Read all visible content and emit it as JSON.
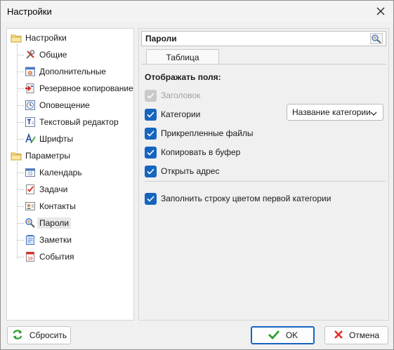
{
  "window": {
    "title": "Настройки"
  },
  "tree": {
    "groups": [
      {
        "label": "Настройки",
        "icon": "folder-icon",
        "items": [
          {
            "label": "Общие",
            "icon": "tools-icon"
          },
          {
            "label": "Дополнительные",
            "icon": "advanced-settings-icon"
          },
          {
            "label": "Резервное копирование",
            "icon": "backup-icon"
          },
          {
            "label": "Оповещение",
            "icon": "notification-icon"
          },
          {
            "label": "Текстовый редактор",
            "icon": "text-editor-icon"
          },
          {
            "label": "Шрифты",
            "icon": "font-icon"
          }
        ]
      },
      {
        "label": "Параметры",
        "icon": "folder-icon",
        "items": [
          {
            "label": "Календарь",
            "icon": "calendar-icon"
          },
          {
            "label": "Задачи",
            "icon": "tasks-icon"
          },
          {
            "label": "Контакты",
            "icon": "contacts-icon"
          },
          {
            "label": "Пароли",
            "icon": "passwords-icon",
            "selected": true
          },
          {
            "label": "Заметки",
            "icon": "notes-icon"
          },
          {
            "label": "События",
            "icon": "events-icon"
          }
        ]
      }
    ]
  },
  "panel": {
    "header": "Пароли",
    "tab": "Таблица",
    "section_title": "Отображать поля:",
    "fields": [
      {
        "label": "Заголовок",
        "checked": true,
        "disabled": true
      },
      {
        "label": "Категории",
        "checked": true
      },
      {
        "label": "Прикрепленные файлы",
        "checked": true
      },
      {
        "label": "Копировать в буфер",
        "checked": true
      },
      {
        "label": "Открыть адрес",
        "checked": true
      }
    ],
    "category_dropdown": "Название категории",
    "fill_row_option": {
      "label": "Заполнить строку цветом первой категории",
      "checked": true
    }
  },
  "buttons": {
    "reset": "Сбросить",
    "ok": "OK",
    "cancel": "Отмена"
  },
  "colors": {
    "accent": "#1565c0",
    "ok_check": "#2e9e2e",
    "cancel_x": "#e0302a",
    "reset_green": "#2e9e2e"
  }
}
